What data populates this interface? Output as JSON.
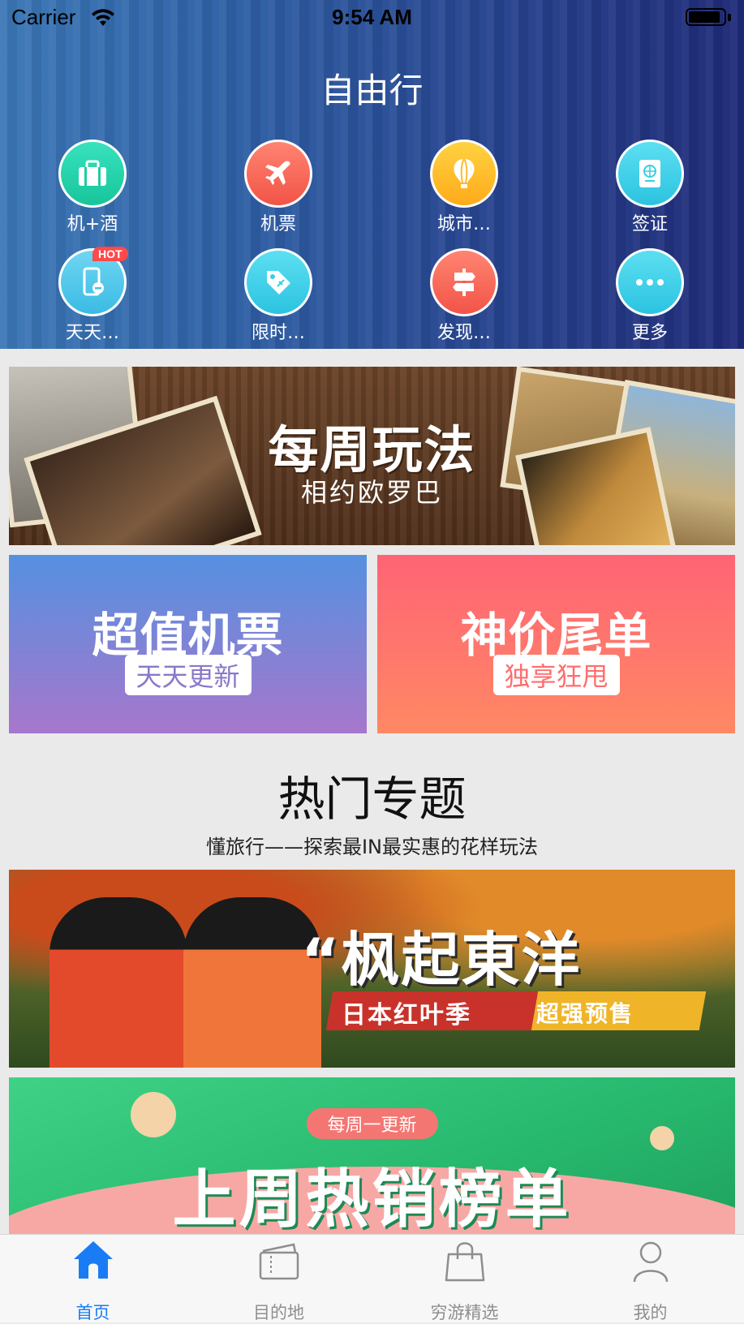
{
  "status_bar": {
    "carrier": "Carrier",
    "time": "9:54 AM"
  },
  "header": {
    "title": "自由行",
    "categories": [
      {
        "label": "机+酒",
        "icon": "briefcase-icon",
        "color": "#1fcba2"
      },
      {
        "label": "机票",
        "icon": "airplane-icon",
        "color": "#f25c4d"
      },
      {
        "label": "城市…",
        "icon": "balloon-icon",
        "color": "#ffbb27"
      },
      {
        "label": "签证",
        "icon": "passport-icon",
        "color": "#35cfe6"
      },
      {
        "label": "天天…",
        "icon": "phone-icon",
        "color": "#45c3e8",
        "badge": "HOT"
      },
      {
        "label": "限时…",
        "icon": "tag-icon",
        "color": "#35cfe6"
      },
      {
        "label": "发现…",
        "icon": "signpost-icon",
        "color": "#f25c4d"
      },
      {
        "label": "更多",
        "icon": "more-icon",
        "color": "#35cfe6"
      }
    ]
  },
  "banners": {
    "weekly": {
      "title": "每周玩法",
      "subtitle": "相约欧罗巴"
    },
    "flight": {
      "title": "超值机票",
      "tag": "天天更新"
    },
    "deal": {
      "title": "神价尾单",
      "tag": "独享狂甩"
    }
  },
  "hot_topics": {
    "title": "热门专题",
    "subtitle": "懂旅行——探索最IN最实惠的花样玩法",
    "japan": {
      "title": "“枫起東洋",
      "subtitle": "日本红叶季",
      "tag": "超强预售"
    },
    "bestseller": {
      "pill": "每周一更新",
      "title": "上周热销榜单"
    }
  },
  "tabbar": {
    "tabs": [
      {
        "label": "首页",
        "icon": "home-icon",
        "active": true
      },
      {
        "label": "目的地",
        "icon": "ticket-icon",
        "active": false
      },
      {
        "label": "穷游精选",
        "icon": "shopping-bag-icon",
        "active": false
      },
      {
        "label": "我的",
        "icon": "person-icon",
        "active": false
      }
    ],
    "active_color": "#1a7cf5",
    "inactive_color": "#8e8e8e"
  }
}
